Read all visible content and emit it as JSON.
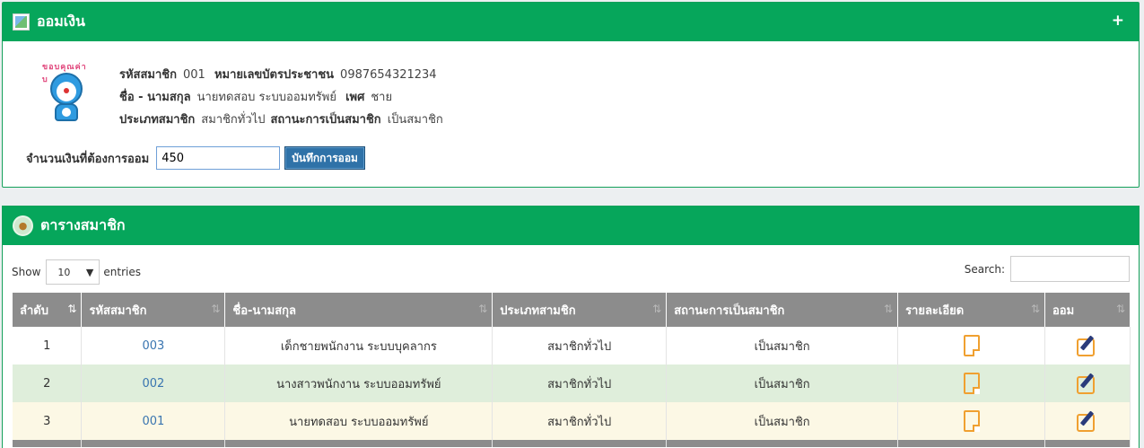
{
  "deposit_panel": {
    "title": "ออมเงิน",
    "plus": "+",
    "avatar_text": "ขอบคุณค่าบ",
    "member_id_label": "รหัสสมาชิก",
    "member_id": "001",
    "national_id_label": "หมายเลขบัตรประชาชน",
    "national_id": "0987654321234",
    "name_label": "ชื่อ - นามสกุล",
    "name": "นายทดสอบ ระบบออมทรัพย์",
    "gender_label": "เพศ",
    "gender": "ชาย",
    "type_label": "ประเภทสมาชิก",
    "type": "สมาชิกทั่วไป",
    "status_label": "สถานะการเป็นสมาชิก",
    "status": "เป็นสมาชิก",
    "amount_label": "จำนวนเงินที่ต้องการออม",
    "amount_value": "450",
    "save_button": "บันทึกการออม"
  },
  "members_panel": {
    "title": "ตารางสมาชิก",
    "show_label": "Show",
    "entries_value": "10",
    "entries_label": "entries",
    "search_label": "Search:",
    "columns": [
      "ลำดับ",
      "รหัสสมาชิก",
      "ชื่อ-นามสกุล",
      "ประเภทสามชิก",
      "สถานะการเป็นสมาชิก",
      "รายละเอียด",
      "ออม"
    ],
    "rows": [
      {
        "no": "1",
        "code": "003",
        "name": "เด็กชายพนักงาน ระบบบุคลากร",
        "type": "สมาชิกทั่วไป",
        "status": "เป็นสมาชิก"
      },
      {
        "no": "2",
        "code": "002",
        "name": "นางสาวพนักงาน ระบบออมทรัพย์",
        "type": "สมาชิกทั่วไป",
        "status": "เป็นสมาชิก"
      },
      {
        "no": "3",
        "code": "001",
        "name": "นายทดสอบ ระบบออมทรัพย์",
        "type": "สมาชิกทั่วไป",
        "status": "เป็นสมาชิก"
      }
    ]
  },
  "colors": {
    "header_green": "#06a65b",
    "table_header": "#8c8c8c",
    "link_blue": "#3a75b0",
    "icon_orange": "#f0a030"
  },
  "icons": [
    "broken-image-icon",
    "piggy-bank-icon",
    "document-icon",
    "edit-icon",
    "sort-icon",
    "dropdown-icon"
  ]
}
